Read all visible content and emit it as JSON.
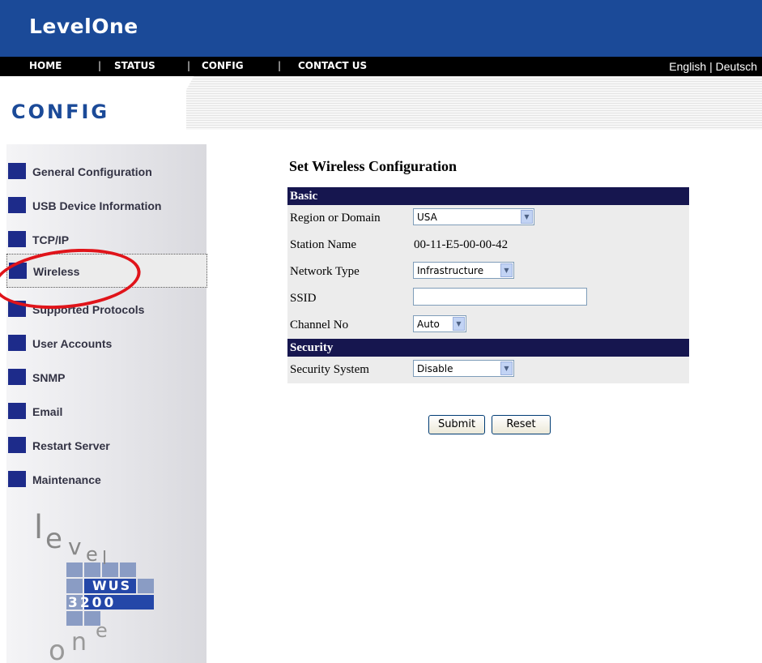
{
  "header": {
    "brand": "LevelOne"
  },
  "nav": {
    "items": [
      "HOME",
      "STATUS",
      "CONFIG",
      "CONTACT US"
    ],
    "separator": "|",
    "lang_en": "English",
    "lang_sep": "|",
    "lang_de": "Deutsch"
  },
  "band": {
    "title": "CONFIG"
  },
  "sidebar": {
    "items": [
      "General Configuration",
      "USB Device Information",
      "TCP/IP",
      "Wireless",
      "Supported Protocols",
      "User Accounts",
      "SNMP",
      "Email",
      "Restart Server",
      "Maintenance"
    ],
    "active": "Wireless",
    "logo_letters": {
      "level": "level",
      "model_top": "WUS",
      "model_num": "3200",
      "one": "one"
    }
  },
  "main": {
    "title": "Set Wireless Configuration",
    "sections": {
      "basic": "Basic",
      "security": "Security"
    },
    "fields": {
      "region_label": "Region or Domain",
      "region_value": "USA",
      "station_label": "Station Name",
      "station_value": "00-11-E5-00-00-42",
      "network_label": "Network Type",
      "network_value": "Infrastructure",
      "ssid_label": "SSID",
      "ssid_value": "",
      "channel_label": "Channel No",
      "channel_value": "Auto",
      "security_label": "Security System",
      "security_value": "Disable"
    },
    "buttons": {
      "submit": "Submit",
      "reset": "Reset"
    }
  },
  "colors": {
    "header_blue": "#1b4a98",
    "section_navy": "#16164f",
    "menu_square": "#1d2b8a",
    "highlight_circle": "#e0141a"
  },
  "icons": {
    "dropdown": "chevron-down-icon"
  }
}
